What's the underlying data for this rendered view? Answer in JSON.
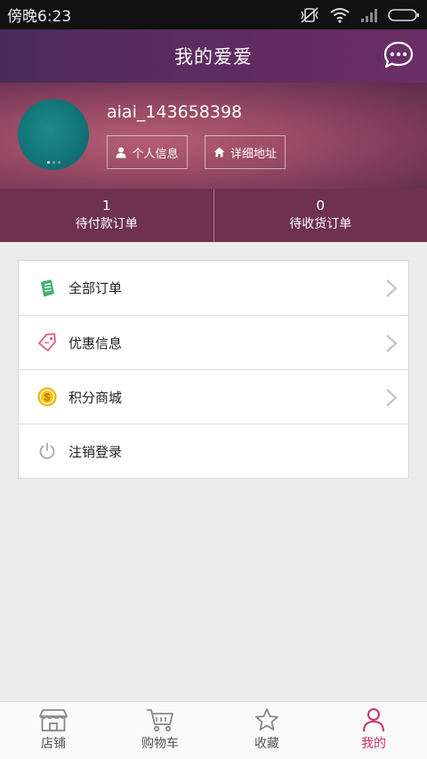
{
  "status_bar": {
    "time": "傍晚6:23"
  },
  "header": {
    "title": "我的爱爱"
  },
  "profile": {
    "username": "aiai_143658398",
    "personal_info_label": "个人信息",
    "address_label": "详细地址"
  },
  "stats": [
    {
      "count": "1",
      "label": "待付款订单"
    },
    {
      "count": "0",
      "label": "待收货订单"
    }
  ],
  "menu": [
    {
      "label": "全部订单",
      "icon": "receipt-icon"
    },
    {
      "label": "优惠信息",
      "icon": "coupon-tag-icon"
    },
    {
      "label": "积分商城",
      "icon": "dollar-coin-icon"
    },
    {
      "label": "注销登录",
      "icon": "power-icon"
    }
  ],
  "bottom_nav": [
    {
      "label": "店铺",
      "icon": "store-icon"
    },
    {
      "label": "购物车",
      "icon": "cart-icon"
    },
    {
      "label": "收藏",
      "icon": "star-icon"
    },
    {
      "label": "我的",
      "icon": "person-icon",
      "active": true
    }
  ],
  "colors": {
    "header": "#5d2c61",
    "accent_active": "#d0306e",
    "avatar": "#127577"
  }
}
